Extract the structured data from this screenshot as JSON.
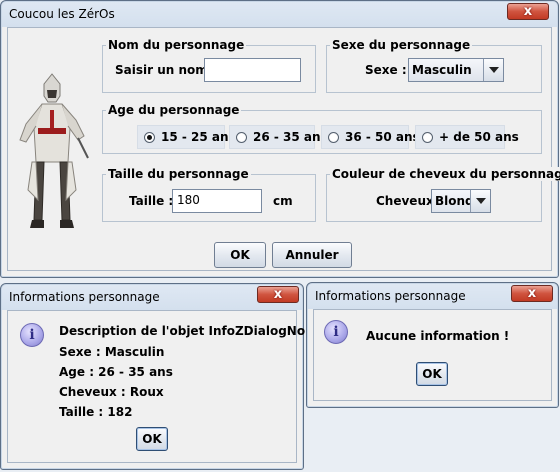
{
  "main_dialog": {
    "title": "Coucou les ZérOs",
    "close_glyph": "x",
    "name_group": {
      "legend": "Nom du personnage",
      "label": "Saisir un nom :",
      "value": ""
    },
    "sex_group": {
      "legend": "Sexe du personnage",
      "label": "Sexe :",
      "selected": "Masculin"
    },
    "age_group": {
      "legend": "Age du personnage",
      "options": [
        "15 - 25 ans",
        "26 - 35 ans",
        "36 - 50 ans",
        "+ de 50 ans"
      ],
      "selected_index": 0
    },
    "size_group": {
      "legend": "Taille du personnage",
      "label": "Taille :",
      "value": "180",
      "unit": "cm"
    },
    "hair_group": {
      "legend": "Couleur de cheveux du personnage",
      "label": "Cheveux",
      "selected": "Blond"
    },
    "ok_label": "OK",
    "cancel_label": "Annuler"
  },
  "info_dialog": {
    "title": "Informations personnage",
    "close_glyph": "x",
    "lines": [
      "Description de l'objet InfoZDialogNom : cysboy",
      "Sexe : Masculin",
      "Age : 26 - 35 ans",
      "Cheveux : Roux",
      "Taille : 182"
    ],
    "ok_label": "OK"
  },
  "empty_dialog": {
    "title": "Informations personnage",
    "close_glyph": "x",
    "message": "Aucune information !",
    "ok_label": "OK"
  },
  "icons": {
    "info": "info-icon",
    "close": "close-icon",
    "dropdown": "chevron-down-icon"
  },
  "colors": {
    "close_button": "#c84a33",
    "info_icon": "#a9a6e8",
    "panel_bg": "#f0f0f0"
  }
}
